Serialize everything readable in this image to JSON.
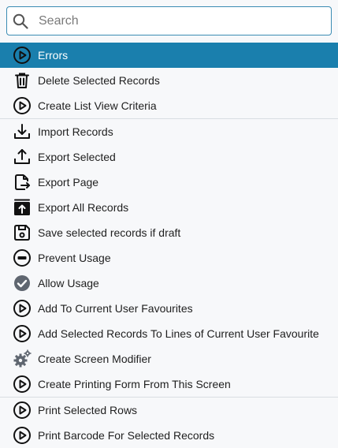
{
  "search": {
    "placeholder": "Search",
    "value": ""
  },
  "menu": {
    "items": [
      {
        "label": "Errors",
        "icon": "play-circle-icon"
      },
      {
        "label": "Delete Selected Records",
        "icon": "trash-icon"
      },
      {
        "label": "Create List View Criteria",
        "icon": "play-circle-icon"
      },
      {
        "label": "Import Records",
        "icon": "download-icon"
      },
      {
        "label": "Export Selected",
        "icon": "upload-icon"
      },
      {
        "label": "Export Page",
        "icon": "file-export-icon"
      },
      {
        "label": "Export All Records",
        "icon": "export-box-icon"
      },
      {
        "label": "Save selected records if draft",
        "icon": "save-icon"
      },
      {
        "label": "Prevent Usage",
        "icon": "minus-circle-icon"
      },
      {
        "label": "Allow Usage",
        "icon": "check-circle-icon"
      },
      {
        "label": "Add To Current User Favourites",
        "icon": "play-circle-icon"
      },
      {
        "label": "Add Selected Records To Lines of Current User Favourite",
        "icon": "play-circle-icon"
      },
      {
        "label": "Create Screen Modifier",
        "icon": "gears-icon"
      },
      {
        "label": "Create Printing Form From This Screen",
        "icon": "play-circle-icon"
      },
      {
        "label": "Print Selected Rows",
        "icon": "play-circle-icon"
      },
      {
        "label": "Print Barcode For Selected Records",
        "icon": "play-circle-icon"
      }
    ]
  },
  "colors": {
    "selected_bg": "#1a7fad",
    "search_border": "#3b8cb3",
    "icon": "#1f1f1f",
    "icon_gray": "#5f6670"
  }
}
